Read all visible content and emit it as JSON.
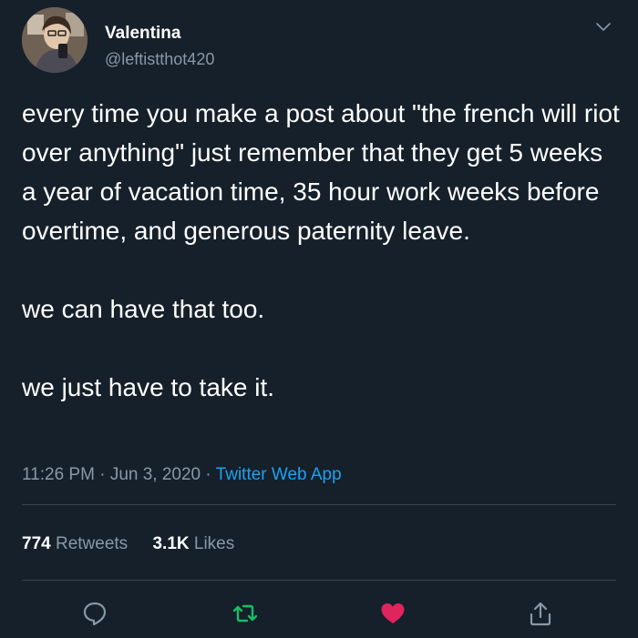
{
  "user": {
    "name": "Valentina",
    "handle": "@leftistthot420"
  },
  "tweet": {
    "paragraphs": [
      "every time you make a post about \"the french will riot over anything\" just remember that they get 5 weeks a year of vacation time, 35 hour work weeks before overtime, and generous paternity leave.",
      "we can have that too.",
      "we just have to take it."
    ],
    "time": "11:26 PM",
    "date": "Jun 3, 2020",
    "separator": "·",
    "source": "Twitter Web App"
  },
  "stats": {
    "retweets_count": "774",
    "retweets_label": "Retweets",
    "likes_count": "3.1K",
    "likes_label": "Likes"
  },
  "icons": {
    "reply": "reply-icon",
    "retweet": "retweet-icon",
    "like": "heart-icon",
    "share": "share-icon",
    "more": "chevron-down-icon"
  },
  "colors": {
    "background": "#15202b",
    "secondary_text": "#8899a6",
    "link": "#1da1f2",
    "retweet_green": "#17bf63",
    "like_red": "#e0245e",
    "divider": "#38444d"
  }
}
